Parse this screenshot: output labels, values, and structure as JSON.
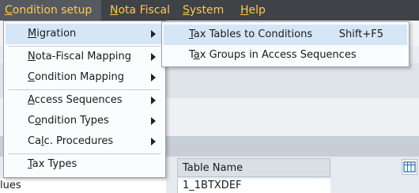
{
  "menubar": {
    "items": [
      {
        "label": "Condition setup",
        "mnemonic": "C",
        "rest": "ondition setup"
      },
      {
        "label": "Nota Fiscal",
        "mnemonic": "N",
        "rest": "ota Fiscal"
      },
      {
        "label": "System",
        "mnemonic": "S",
        "rest": "ystem"
      },
      {
        "label": "Help",
        "mnemonic": "H",
        "rest": "elp"
      }
    ]
  },
  "condition_menu": {
    "items": [
      {
        "label": "Migration",
        "pre": "",
        "mnemonic": "M",
        "rest": "igration",
        "submenu": true
      },
      {
        "label": "Nota-Fiscal Mapping",
        "pre": "",
        "mnemonic": "N",
        "rest": "ota-Fiscal Mapping",
        "submenu": true
      },
      {
        "label": "Condition Mapping",
        "pre": "",
        "mnemonic": "C",
        "rest": "ondition Mapping",
        "submenu": true
      },
      {
        "label": "Access Sequences",
        "pre": "",
        "mnemonic": "A",
        "rest": "ccess Sequences",
        "submenu": true
      },
      {
        "label": "Condition Types",
        "pre": "C",
        "mnemonic": "o",
        "rest": "ndition Types",
        "submenu": true
      },
      {
        "label": "Calc. Procedures",
        "pre": "Ca",
        "mnemonic": "l",
        "rest": "c. Procedures",
        "submenu": true
      },
      {
        "label": "Tax Types",
        "pre": "",
        "mnemonic": "T",
        "rest": "ax Types",
        "submenu": false
      }
    ]
  },
  "migration_submenu": {
    "items": [
      {
        "label": "Tax Tables to Conditions",
        "mnemonic": "T",
        "rest": "ax Tables to Conditions",
        "shortcut": "Shift+F5"
      },
      {
        "label": "Tax Groups in Access Sequences",
        "pre": "T",
        "mnemonic": "a",
        "rest": "x Groups in Access Sequences",
        "shortcut": ""
      }
    ]
  },
  "table": {
    "column_header": "Table Name",
    "cell_value": "1_1BTXDEF",
    "left_cell_partial": "alues"
  },
  "colors": {
    "menubar_bg": "#3f4247",
    "menubar_text": "#ffc94a",
    "menu_highlight": "#d5e7f6"
  }
}
